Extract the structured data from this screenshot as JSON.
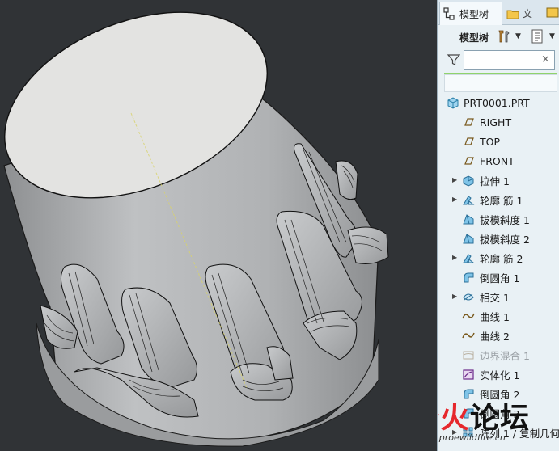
{
  "tabs": {
    "model_tree": "模型树",
    "file": "文"
  },
  "toolbar": {
    "label": "模型树"
  },
  "search": {
    "value": "",
    "clear": "×"
  },
  "tree": {
    "root": "PRT0001.PRT",
    "items": [
      {
        "label": "RIGHT",
        "icon": "datum-plane-icon",
        "expandable": false,
        "disabled": false
      },
      {
        "label": "TOP",
        "icon": "datum-plane-icon",
        "expandable": false,
        "disabled": false
      },
      {
        "label": "FRONT",
        "icon": "datum-plane-icon",
        "expandable": false,
        "disabled": false
      },
      {
        "label": "拉伸 1",
        "icon": "extrude-icon",
        "expandable": true,
        "disabled": false
      },
      {
        "label": "轮廓 筋 1",
        "icon": "rib-icon",
        "expandable": true,
        "disabled": false
      },
      {
        "label": "拔模斜度 1",
        "icon": "draft-icon",
        "expandable": false,
        "disabled": false
      },
      {
        "label": "拔模斜度 2",
        "icon": "draft-icon",
        "expandable": false,
        "disabled": false
      },
      {
        "label": "轮廓 筋 2",
        "icon": "rib-icon",
        "expandable": true,
        "disabled": false
      },
      {
        "label": "倒圆角 1",
        "icon": "round-icon",
        "expandable": false,
        "disabled": false
      },
      {
        "label": "相交 1",
        "icon": "intersect-icon",
        "expandable": true,
        "disabled": false
      },
      {
        "label": "曲线 1",
        "icon": "curve-icon",
        "expandable": false,
        "disabled": false
      },
      {
        "label": "曲线 2",
        "icon": "curve-icon",
        "expandable": false,
        "disabled": false
      },
      {
        "label": "边界混合 1",
        "icon": "boundary-blend-icon",
        "expandable": false,
        "disabled": true
      },
      {
        "label": "实体化 1",
        "icon": "solidify-icon",
        "expandable": false,
        "disabled": false
      },
      {
        "label": "倒圆角 2",
        "icon": "round-icon",
        "expandable": false,
        "disabled": false
      },
      {
        "label": "倒圆角 3",
        "icon": "round-icon",
        "expandable": false,
        "disabled": false
      },
      {
        "label": "阵列 1 / 复制几何",
        "icon": "pattern-icon",
        "expandable": true,
        "disabled": false
      }
    ]
  },
  "watermark": {
    "part1": "野火",
    "part2": "论坛",
    "url": "www.proewildfire.cn"
  },
  "colors": {
    "viewport_bg": "#303336",
    "panel_bg": "#e9f1f5",
    "model_body": "#b4b6b8",
    "model_top": "#e3e3e1",
    "watermark_red": "#e6272c"
  }
}
